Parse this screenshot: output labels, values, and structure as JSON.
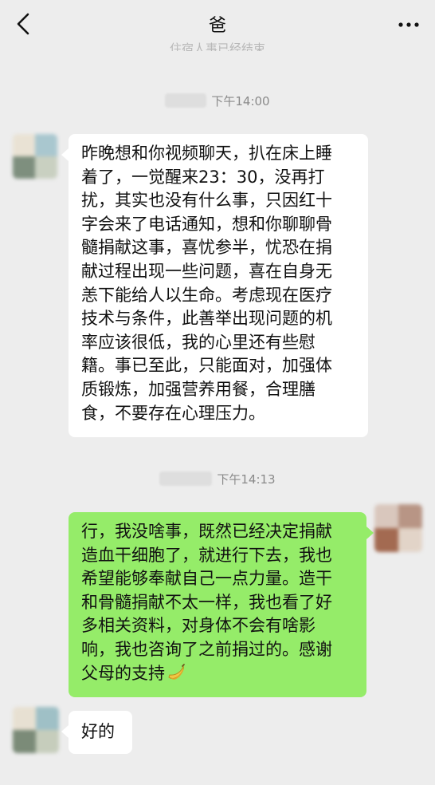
{
  "header": {
    "title": "爸",
    "faded_system_text": "住宿人事已经结束"
  },
  "colors": {
    "background": "#ededed",
    "incoming_bubble": "#ffffff",
    "outgoing_bubble": "#95ec69",
    "timestamp_text": "#8a8a8a"
  },
  "messages": [
    {
      "time": "下午14:00",
      "sender": "爸",
      "lines": [
        "昨晚想和你视频聊天，扒在床上睡",
        "着了，一觉醒来23：30，没再打",
        "扰，其实也没有什么事，只因红十",
        "字会来了电话通知，想和你聊聊骨",
        "髓捐献这事，喜忧参半，忧恐在捐",
        "献过程出现一些问题，喜在自身无",
        "恙下能给人以生命。考虑现在医疗",
        "技术与条件，此善举出现问题的机",
        "率应该很低，我的心里还有些慰",
        "籍。事已至此，只能面对，加强体",
        "质锻炼，加强营养用餐，合理膳",
        "食，不要存在心理压力。"
      ]
    },
    {
      "time": "下午14:13",
      "sender": "me",
      "lines": [
        "行，我没啥事，既然已经决定捐献",
        "造血干细胞了，就进行下去，我也",
        "希望能够奉献自己一点力量。造干",
        "和骨髓捐献不太一样，我也看了好",
        "多相关资料，对身体不会有啥影",
        "响，我也咨询了之前捐过的。感谢",
        "父母的支持"
      ],
      "trailing_icon": "banana-emoji"
    },
    {
      "sender": "爸",
      "lines": [
        "好的"
      ]
    }
  ]
}
